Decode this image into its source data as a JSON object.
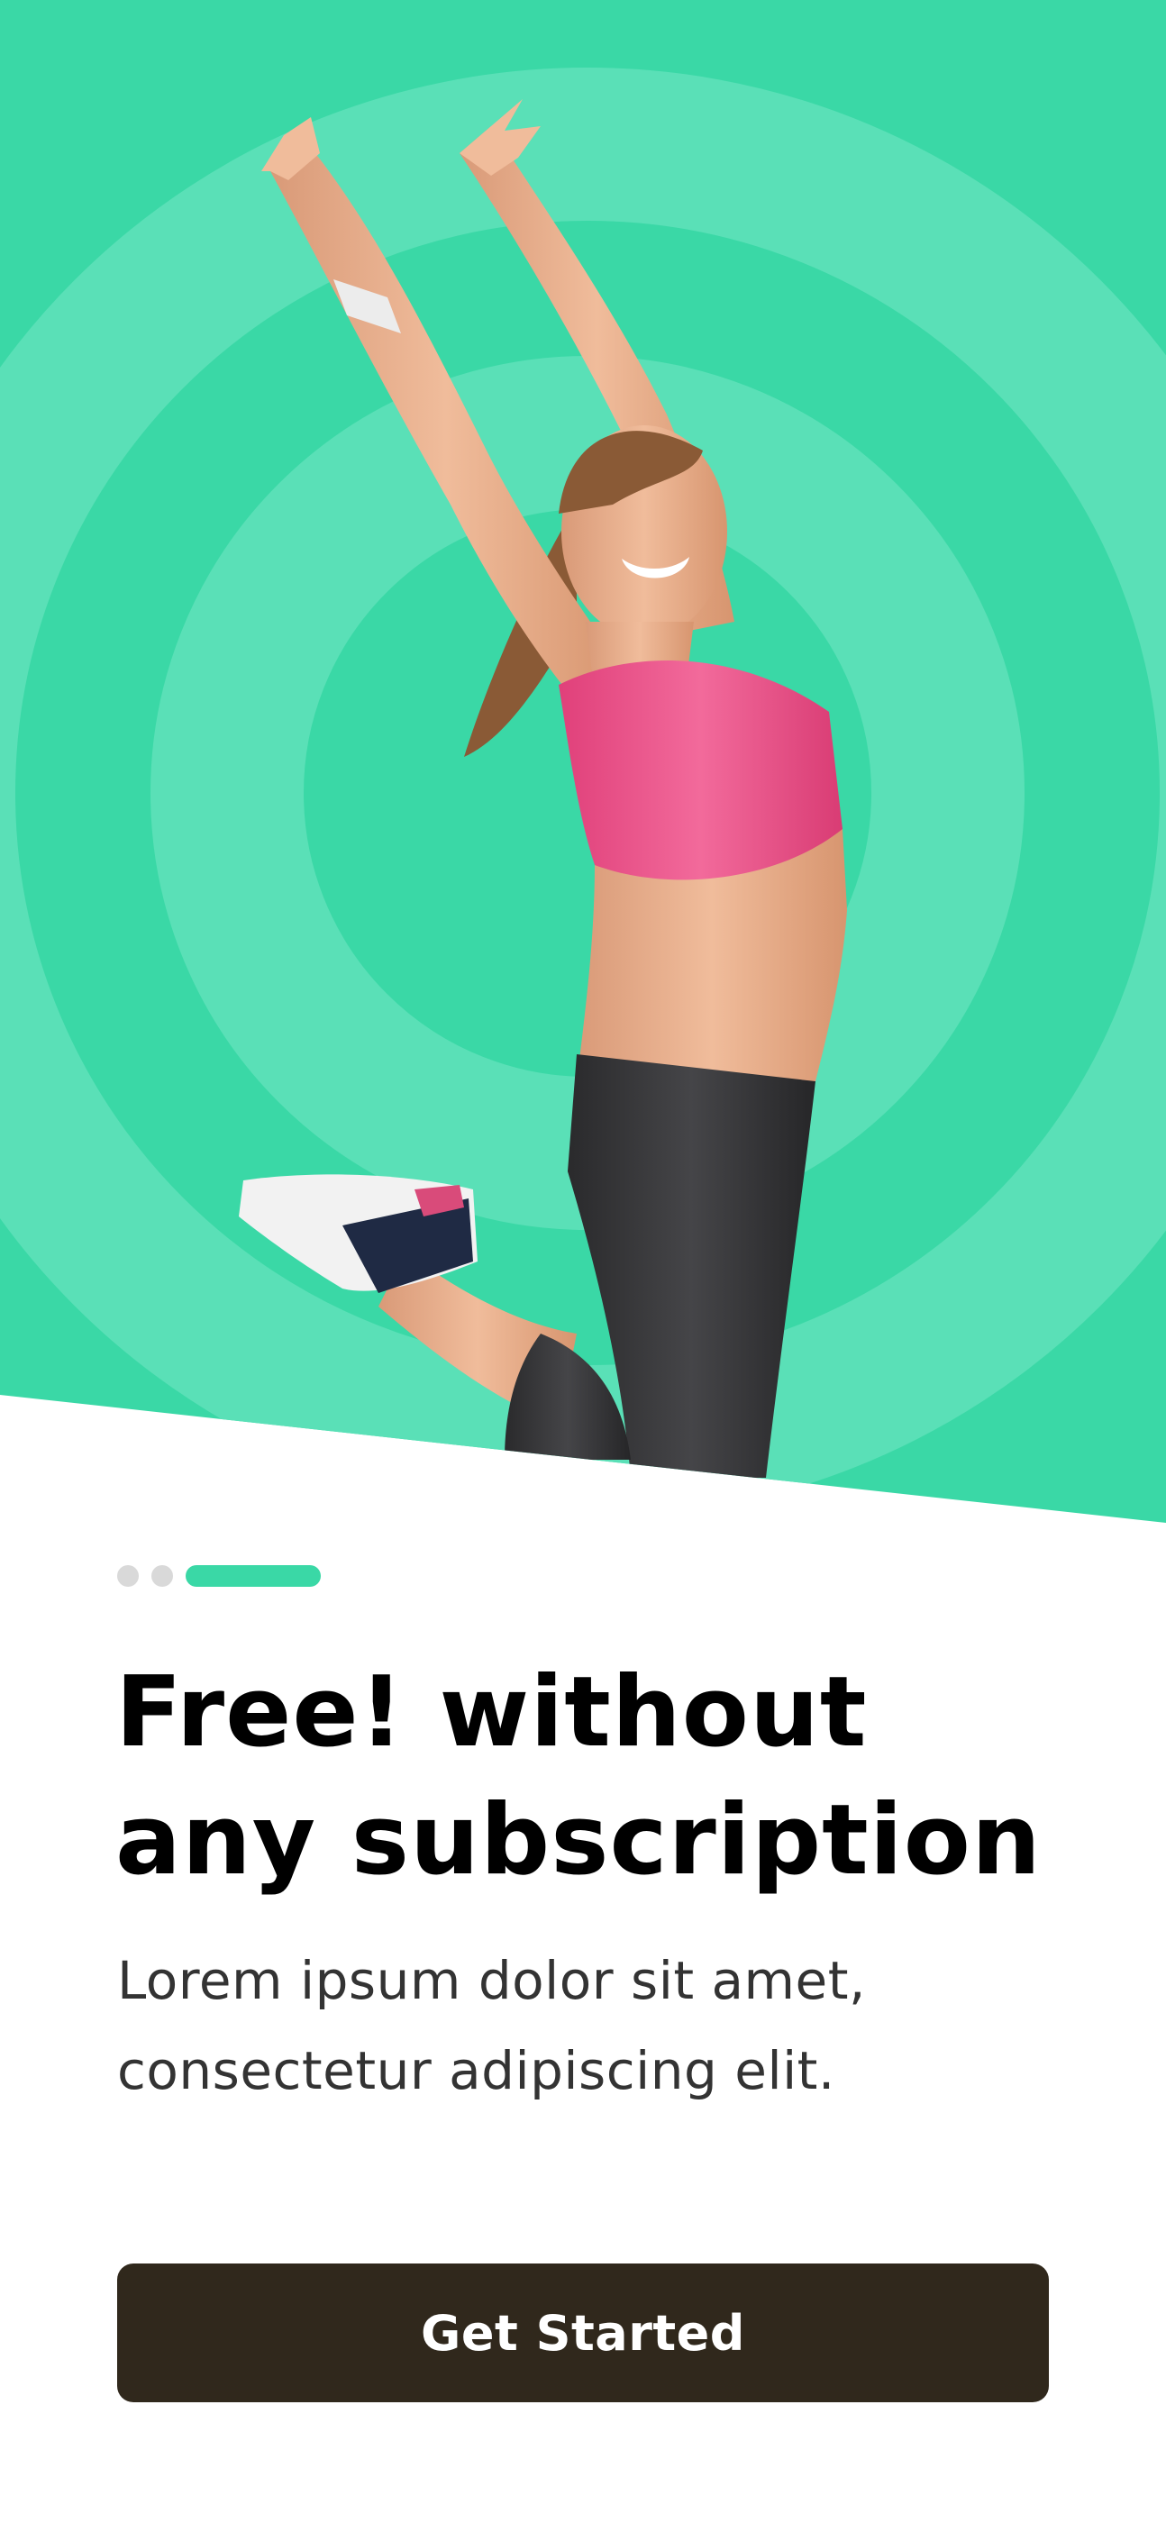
{
  "onboarding": {
    "pager": {
      "total": 3,
      "active_index": 2
    },
    "title": "Free! without any subscription",
    "subtitle": "Lorem ipsum dolor sit amet, consectetur adipiscing elit.",
    "cta_label": "Get Started"
  },
  "colors": {
    "hero_background": "#3ad8a6",
    "hero_rings": "#5ae0b7",
    "accent": "#3ad8a6",
    "inactive_dot": "#d9d9d9",
    "button_background": "#30281c",
    "button_text": "#ffffff",
    "title_text": "#000000",
    "body_text": "#333333"
  },
  "hero": {
    "image": "woman-jumping-fitness-photo"
  }
}
